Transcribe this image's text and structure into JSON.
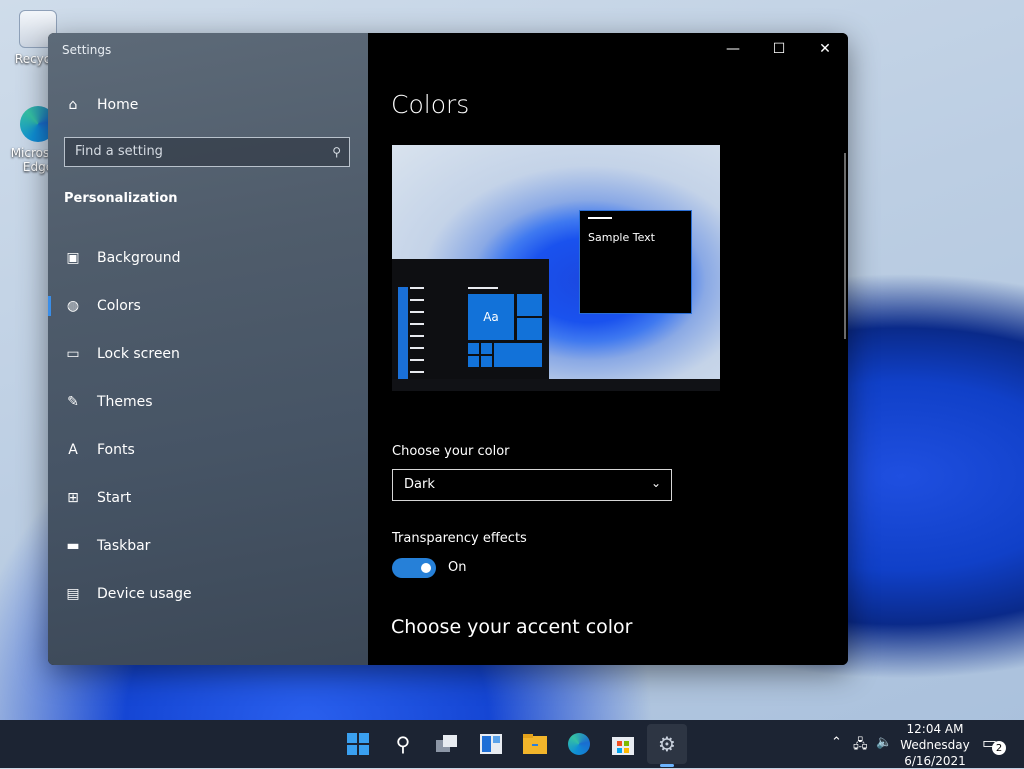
{
  "desktop": {
    "icons": [
      {
        "label": "Recycle"
      },
      {
        "label": "Microsoft Edge"
      }
    ]
  },
  "window": {
    "title": "Settings",
    "controls": {
      "minimize": "—",
      "maximize": "☐",
      "close": "✕"
    }
  },
  "sidebar": {
    "home": "Home",
    "search": {
      "placeholder": "Find a setting"
    },
    "section": "Personalization",
    "items": [
      {
        "label": "Background",
        "icon": "image-icon"
      },
      {
        "label": "Colors",
        "icon": "palette-icon",
        "active": true
      },
      {
        "label": "Lock screen",
        "icon": "lock-screen-icon"
      },
      {
        "label": "Themes",
        "icon": "brush-icon"
      },
      {
        "label": "Fonts",
        "icon": "font-icon"
      },
      {
        "label": "Start",
        "icon": "start-icon"
      },
      {
        "label": "Taskbar",
        "icon": "taskbar-icon"
      },
      {
        "label": "Device usage",
        "icon": "device-usage-icon"
      }
    ]
  },
  "main": {
    "title": "Colors",
    "preview": {
      "sample_text": "Sample Text",
      "tile_label": "Aa"
    },
    "choose_color": {
      "label": "Choose your color",
      "value": "Dark"
    },
    "transparency": {
      "label": "Transparency effects",
      "state": "On",
      "enabled": true
    },
    "accent_title": "Choose your accent color"
  },
  "taskbar": {
    "apps": [
      "start-icon",
      "search-icon",
      "task-view-icon",
      "widgets-icon",
      "file-explorer-icon",
      "edge-icon",
      "store-icon",
      "settings-icon"
    ],
    "clock": {
      "time": "12:04 AM",
      "day": "Wednesday",
      "date": "6/16/2021"
    },
    "notifications_count": "2"
  },
  "colors": {
    "accent": "#2680d8",
    "sidebar": "#4f5c6b",
    "content_bg": "#000000"
  }
}
